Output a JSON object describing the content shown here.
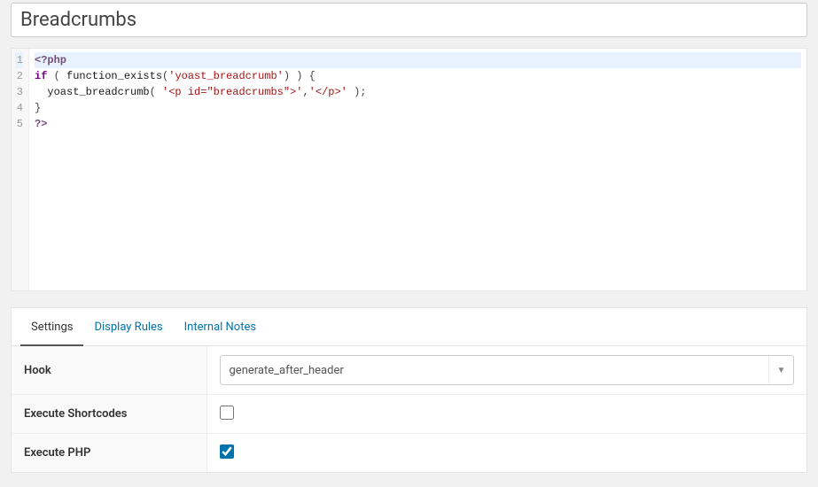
{
  "title": "Breadcrumbs",
  "code": {
    "lines": [
      {
        "n": 1,
        "tokens": [
          {
            "t": "<?php",
            "c": "t-meta"
          }
        ],
        "hl": true
      },
      {
        "n": 2,
        "tokens": [
          {
            "t": "if",
            "c": "t-kw"
          },
          {
            "t": " ( ",
            "c": "t-punct"
          },
          {
            "t": "function_exists",
            "c": "t-fn"
          },
          {
            "t": "(",
            "c": "t-punct"
          },
          {
            "t": "'yoast_breadcrumb'",
            "c": "t-str"
          },
          {
            "t": ") ) {",
            "c": "t-punct"
          }
        ]
      },
      {
        "n": 3,
        "tokens": [
          {
            "t": "  ",
            "c": ""
          },
          {
            "t": "yoast_breadcrumb",
            "c": "t-fn"
          },
          {
            "t": "( ",
            "c": "t-punct"
          },
          {
            "t": "'<p id=\"breadcrumbs\">'",
            "c": "t-str"
          },
          {
            "t": ",",
            "c": "t-punct"
          },
          {
            "t": "'</p>'",
            "c": "t-str"
          },
          {
            "t": " );",
            "c": "t-punct"
          }
        ]
      },
      {
        "n": 4,
        "tokens": [
          {
            "t": "}",
            "c": "t-punct"
          }
        ]
      },
      {
        "n": 5,
        "tokens": [
          {
            "t": "?>",
            "c": "t-meta"
          }
        ]
      }
    ]
  },
  "tabs": [
    {
      "label": "Settings",
      "active": true
    },
    {
      "label": "Display Rules",
      "active": false
    },
    {
      "label": "Internal Notes",
      "active": false
    }
  ],
  "settings": {
    "hook": {
      "label": "Hook",
      "value": "generate_after_header"
    },
    "shortcodes": {
      "label": "Execute Shortcodes",
      "checked": false
    },
    "php": {
      "label": "Execute PHP",
      "checked": true
    }
  }
}
